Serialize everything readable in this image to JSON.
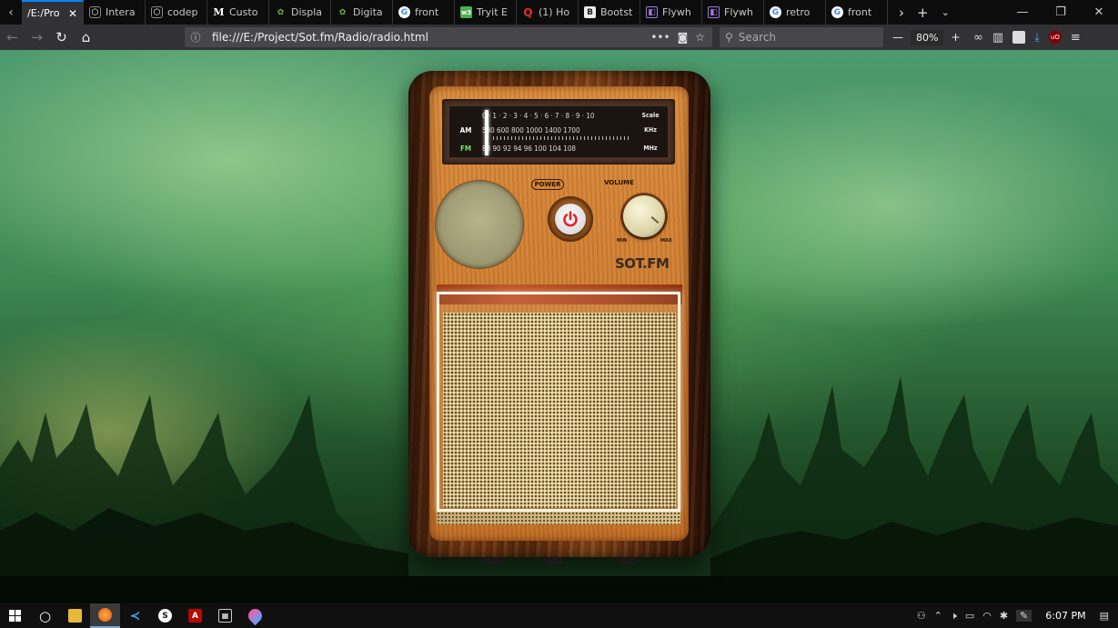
{
  "browser": {
    "tabs": [
      {
        "label": "/E:/Pro",
        "icon": "",
        "active": true
      },
      {
        "label": "Intera",
        "icon": "codepen-icon"
      },
      {
        "label": "codep",
        "icon": "codepen-icon"
      },
      {
        "label": "Custo",
        "icon": "medium-icon"
      },
      {
        "label": "Displa",
        "icon": "dribbble-icon"
      },
      {
        "label": "Digita",
        "icon": "dribbble-icon"
      },
      {
        "label": "front",
        "icon": "google-icon"
      },
      {
        "label": "Tryit E",
        "icon": "w3schools-icon"
      },
      {
        "label": "(1) Ho",
        "icon": "quora-icon"
      },
      {
        "label": "Bootst",
        "icon": "bootstrap-icon"
      },
      {
        "label": "Flywh",
        "icon": "flywheel-icon"
      },
      {
        "label": "Flywh",
        "icon": "flywheel-icon"
      },
      {
        "label": "retro",
        "icon": "google-icon"
      },
      {
        "label": "front",
        "icon": "google-icon"
      }
    ],
    "url": "file:///E:/Project/Sot.fm/Radio/radio.html",
    "search_placeholder": "Search",
    "zoom": "80%"
  },
  "radio": {
    "dial": {
      "scale_row": "0 · 1 · 2 · 3 · 4 · 5 · 6 · 7 · 8 · 9 · 10",
      "scale_label": "Scale",
      "am_label": "AM",
      "am_row": "530 600      800 1000      1400 1700",
      "am_unit": "KHz",
      "fm_label": "FM",
      "fm_row": "88 90 92 94 96    100   104   108",
      "fm_unit": "MHz"
    },
    "power_label": "POWER",
    "volume_label": "VOLUME",
    "volume_min": "MIN",
    "volume_max": "MAX",
    "brand": "SOT.FM"
  },
  "taskbar": {
    "time": "6:07 PM"
  },
  "colors": {
    "power_red": "#e8202a",
    "fm_green": "#7fdc6a",
    "wood": "#c57326"
  }
}
